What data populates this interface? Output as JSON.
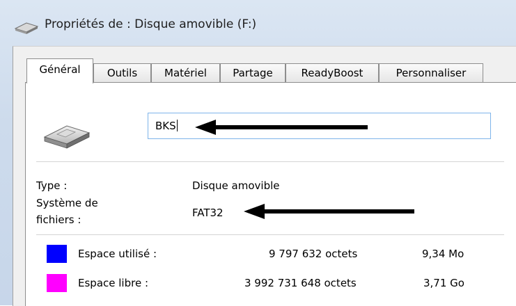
{
  "window": {
    "title": "Propriétés de : Disque amovible (F:)"
  },
  "tabs": [
    {
      "label": "Général",
      "active": true
    },
    {
      "label": "Outils"
    },
    {
      "label": "Matériel"
    },
    {
      "label": "Partage"
    },
    {
      "label": "ReadyBoost"
    },
    {
      "label": "Personnaliser"
    }
  ],
  "general": {
    "volume_name": "BKS",
    "type_label": "Type :",
    "type_value": "Disque amovible",
    "fs_label_1": "Système de",
    "fs_label_2": "fichiers :",
    "fs_value": "FAT32",
    "used": {
      "label": "Espace utilisé :",
      "bytes": "9 797 632 octets",
      "size": "9,34 Mo",
      "color": "#0000ff"
    },
    "free": {
      "label": "Espace libre :",
      "bytes": "3 992 731 648 octets",
      "size": "3,71 Go",
      "color": "#ff00ff"
    }
  },
  "icons": {
    "title": "drive-icon",
    "drive": "removable-drive-icon",
    "arrows": "arrow-left-icon"
  }
}
